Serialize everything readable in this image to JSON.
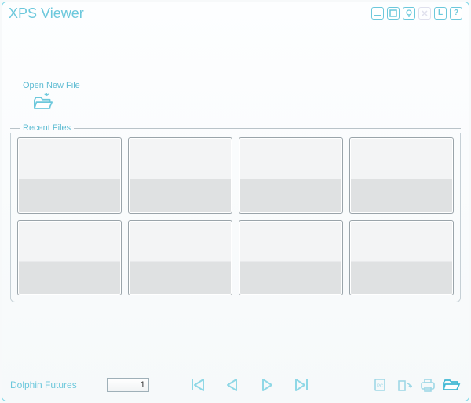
{
  "window": {
    "title": "XPS Viewer"
  },
  "titlebar_buttons": {
    "minimize": "minimize",
    "maximize": "maximize",
    "mute": "mute",
    "close": "close",
    "layout": "L",
    "help": "?"
  },
  "sections": {
    "open_new": {
      "label": "Open New File"
    },
    "recent": {
      "label": "Recent Files",
      "items": [
        {
          "name": "recent-1"
        },
        {
          "name": "recent-2"
        },
        {
          "name": "recent-3"
        },
        {
          "name": "recent-4"
        },
        {
          "name": "recent-5"
        },
        {
          "name": "recent-6"
        },
        {
          "name": "recent-7"
        },
        {
          "name": "recent-8"
        }
      ]
    }
  },
  "footer": {
    "brand": "Dolphin Futures",
    "page": "1"
  }
}
